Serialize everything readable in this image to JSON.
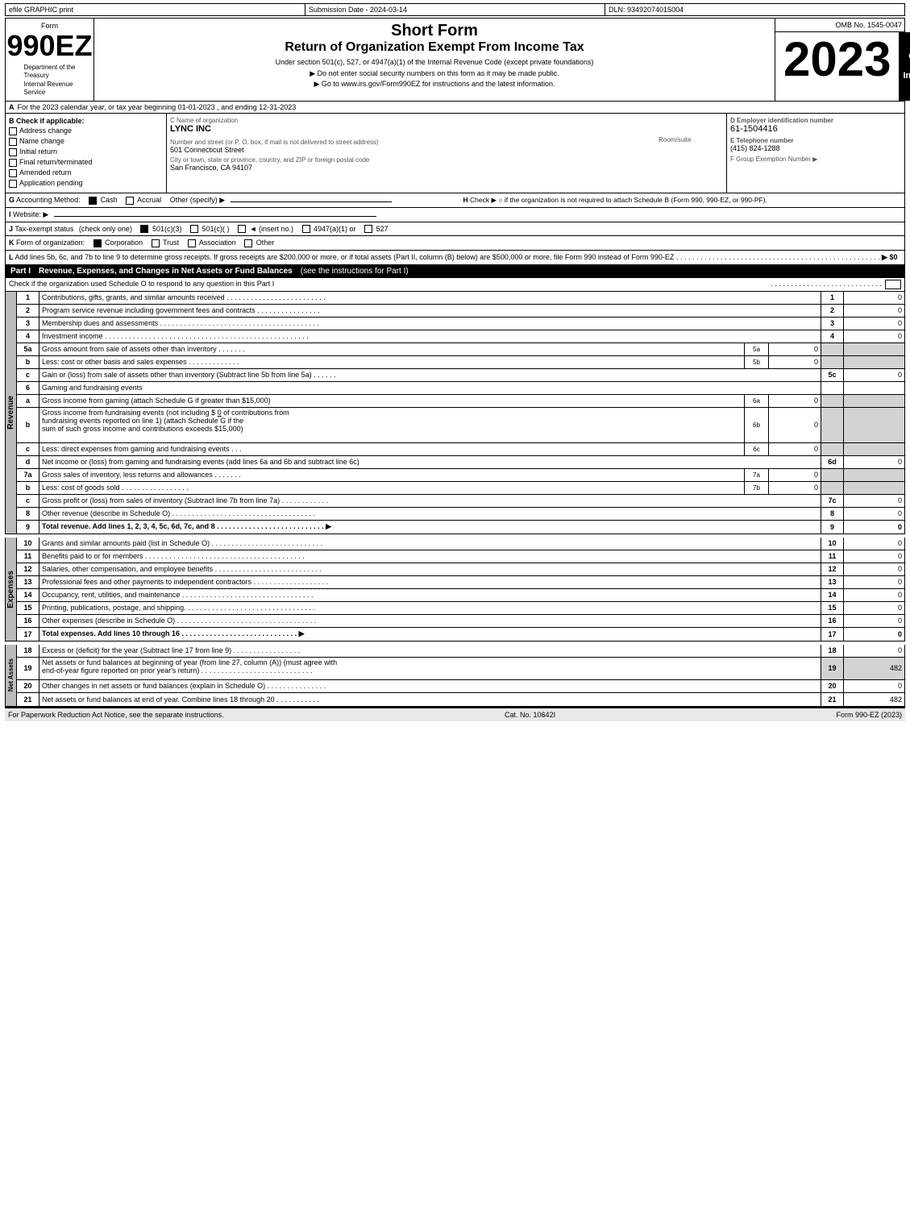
{
  "header": {
    "efile_label": "efile GRAPHIC print",
    "submission_label": "Submission Date - 2024-03-14",
    "dln_label": "DLN: 93492074015004",
    "form_label": "Form",
    "form_number": "990EZ",
    "dept_line1": "Department of the",
    "dept_line2": "Treasury",
    "dept_line3": "Internal Revenue",
    "dept_line4": "Service",
    "title_short": "Short Form",
    "title_main": "Return of Organization Exempt From Income Tax",
    "subtitle": "Under section 501(c), 527, or 4947(a)(1) of the Internal Revenue Code (except private foundations)",
    "note1": "▶ Do not enter social security numbers on this form as it may be made public.",
    "note2": "▶ Go to www.irs.gov/Form990EZ for instructions and the latest information.",
    "omb": "OMB No. 1545-0047",
    "year": "2023",
    "open_inspection": "Open to\nPublic\nInspection"
  },
  "section_a": {
    "label": "A",
    "text": "For the 2023 calendar year, or tax year beginning 01-01-2023 , and ending 12-31-2023"
  },
  "section_b": {
    "label": "B",
    "check_label": "Check if applicable:",
    "items": [
      {
        "id": "address-change",
        "label": "Address change",
        "checked": false
      },
      {
        "id": "name-change",
        "label": "Name change",
        "checked": false
      },
      {
        "id": "initial-return",
        "label": "Initial return",
        "checked": false
      },
      {
        "id": "final-return",
        "label": "Final return/terminated",
        "checked": false
      },
      {
        "id": "amended-return",
        "label": "Amended return",
        "checked": false
      },
      {
        "id": "app-pending",
        "label": "Application pending",
        "checked": false
      }
    ]
  },
  "org": {
    "name_label": "C Name of organization",
    "name": "LYNC INC",
    "address_label": "Number and street (or P. O. box, if mail is not delivered to street address)",
    "address": "501 Connecticut Street",
    "room_label": "Room/suite",
    "room": "",
    "city_label": "City or town, state or province, country, and ZIP or foreign postal code",
    "city": "San Francisco, CA  94107"
  },
  "ein": {
    "label": "D Employer identification number",
    "number": "61-1504416",
    "phone_label": "E Telephone number",
    "phone": "(415) 824-1288",
    "group_label": "F Group Exemption\nNumber",
    "group_arrow": "▶"
  },
  "accounting": {
    "label": "G",
    "method_label": "Accounting Method:",
    "cash_label": "Cash",
    "cash_checked": true,
    "accrual_label": "Accrual",
    "accrual_checked": false,
    "other_label": "Other (specify) ▶",
    "h_label": "H",
    "h_check_label": "Check ▶",
    "h_text": "○ if the organization is not required to attach Schedule B (Form 990, 990-EZ, or 990-PF)."
  },
  "website": {
    "label": "I",
    "text": "Website: ▶"
  },
  "tax_exempt": {
    "label": "J",
    "text": "Tax-exempt status",
    "note": "(check only one)",
    "options": [
      {
        "label": "501(c)(3)",
        "checked": true
      },
      {
        "label": "501(c)(  )",
        "checked": false
      },
      {
        "label": "◄ (insert no.)",
        "checked": false
      },
      {
        "label": "4947(a)(1) or",
        "checked": false
      },
      {
        "label": "527",
        "checked": false
      }
    ]
  },
  "form_org": {
    "label": "K",
    "text": "Form of organization:",
    "options": [
      {
        "label": "Corporation",
        "checked": true
      },
      {
        "label": "Trust",
        "checked": false
      },
      {
        "label": "Association",
        "checked": false
      },
      {
        "label": "Other",
        "checked": false
      }
    ]
  },
  "add_lines": {
    "label": "L",
    "text": "Add lines 5b, 6c, and 7b to line 9 to determine gross receipts. If gross receipts are $200,000 or more, or if total assets (Part II, column (B) below) are $500,000 or more, file Form 990 instead of Form 990-EZ",
    "dots": ". . . . . . . . . . . . . . . . . . . . . . . . . . . . . . . . . . . . . . . . . . . . . . . . . . .",
    "arrow": "▶ $0"
  },
  "part1": {
    "label": "Part I",
    "title": "Revenue, Expenses, and Changes in Net Assets or Fund Balances",
    "subtitle": "(see the instructions for Part I)",
    "check_note": "Check if the organization used Schedule O to respond to any question in this Part I",
    "check_dots": ". . . . . . . . . . . . . . . . . . . . . . . . . . . .",
    "check_box": "□",
    "rows": [
      {
        "num": "1",
        "desc": "Contributions, gifts, grants, and similar amounts received . . . . . . . . . . . . . . . . . . . . . . . . .",
        "line": "1",
        "amount": "0"
      },
      {
        "num": "2",
        "desc": "Program service revenue including government fees and contracts . . . . . . . . . . . . . . . .",
        "line": "2",
        "amount": "0"
      },
      {
        "num": "3",
        "desc": "Membership dues and assessments . . . . . . . . . . . . . . . . . . . . . . . . . . . . . . . . . . . . . . . .",
        "line": "3",
        "amount": "0"
      },
      {
        "num": "4",
        "desc": "Investment income . . . . . . . . . . . . . . . . . . . . . . . . . . . . . . . . . . . . . . . . . . . . . . . . . . .",
        "line": "4",
        "amount": "0"
      }
    ],
    "row5a": {
      "num": "5a",
      "desc": "Gross amount from sale of assets other than inventory . . . . . . .",
      "ref": "5a",
      "ref_val": "0"
    },
    "row5b": {
      "num": "b",
      "desc": "Less: cost or other basis and sales expenses . . . . . . . . . . . . .",
      "ref": "5b",
      "ref_val": "0"
    },
    "row5c": {
      "num": "c",
      "desc": "Gain or (loss) from sale of assets other than inventory (Subtract line 5b from line 5a) . . . . . .",
      "line": "5c",
      "amount": "0"
    },
    "row6_header": {
      "num": "6",
      "desc": "Gaming and fundraising events"
    },
    "row6a": {
      "num": "a",
      "desc": "Gross income from gaming (attach Schedule G if greater than $15,000)",
      "ref": "6a",
      "ref_val": "0"
    },
    "row6b_desc": "Gross income from fundraising events (not including $ 0                    of contributions from\nfundraising events reported on line 1) (attach Schedule G if the\nsum of such gross income and contributions exceeds $15,000)",
    "row6b": {
      "num": "b",
      "ref": "6b",
      "ref_val": "0"
    },
    "row6c": {
      "num": "c",
      "desc": "Less: direct expenses from gaming and fundraising events       .   .   .",
      "ref": "6c",
      "ref_val": "0"
    },
    "row6d": {
      "num": "d",
      "desc": "Net income or (loss) from gaming and fundraising events (add lines 6a and 6b and subtract line 6c)",
      "line": "6d",
      "amount": "0"
    },
    "row7a": {
      "num": "7a",
      "desc": "Gross sales of inventory, less returns and allowances . . . . . . .",
      "ref": "7a",
      "ref_val": "0"
    },
    "row7b": {
      "num": "b",
      "desc": "Less: cost of goods sold         .  .  .  .  .  .  .  .  .  .  .  .  .  .  .  .  .",
      "ref": "7b",
      "ref_val": "0"
    },
    "row7c": {
      "num": "c",
      "desc": "Gross profit or (loss) from sales of inventory (Subtract line 7b from line 7a)  . . . . . . . . . . . .",
      "line": "7c",
      "amount": "0"
    },
    "row8": {
      "num": "8",
      "desc": "Other revenue (describe in Schedule O) . . . . . . . . . . . . . . . . . . . . . . . . . . . . . . . . . . . .",
      "line": "8",
      "amount": "0"
    },
    "row9": {
      "num": "9",
      "desc": "Total revenue. Add lines 1, 2, 3, 4, 5c, 6d, 7c, and 8 . . . . . . . . . . . . . . . . . . . . . . . . . . .",
      "line": "9",
      "amount": "0",
      "bold": true,
      "arrow": "▶"
    }
  },
  "expenses_section": {
    "label": "Expenses",
    "rows": [
      {
        "num": "10",
        "desc": "Grants and similar amounts paid (list in Schedule O) . . . . . . . . . . . . . . . . . . . . . . . . . . . .",
        "line": "10",
        "amount": "0"
      },
      {
        "num": "11",
        "desc": "Benefits paid to or for members   . . . . . . . . . . . . . . . . . . . . . . . . . . . . . . . . . . . . . . . .",
        "line": "11",
        "amount": "0"
      },
      {
        "num": "12",
        "desc": "Salaries, other compensation, and employee benefits . . . . . . . . . . . . . . . . . . . . . . . . . . .",
        "line": "12",
        "amount": "0"
      },
      {
        "num": "13",
        "desc": "Professional fees and other payments to independent contractors . . . . . . . . . . . . . . . . . . .",
        "line": "13",
        "amount": "0"
      },
      {
        "num": "14",
        "desc": "Occupancy, rent, utilities, and maintenance . . . . . . . . . . . . . . . . . . . . . . . . . . . . . . . . .",
        "line": "14",
        "amount": "0"
      },
      {
        "num": "15",
        "desc": "Printing, publications, postage, and shipping. . . . . . . . . . . . . . . . . . . . . . . . . . . . . . . . .",
        "line": "15",
        "amount": "0"
      },
      {
        "num": "16",
        "desc": "Other expenses (describe in Schedule O)  . . . . . . . . . . . . . . . . . . . . . . . . . . . . . . . . . .",
        "line": "16",
        "amount": "0"
      },
      {
        "num": "17",
        "desc": "Total expenses. Add lines 10 through 16     . . . . . . . . . . . . . . . . . . . . . . . . . . . . . .",
        "line": "17",
        "amount": "0",
        "bold": true,
        "arrow": "▶"
      }
    ]
  },
  "net_assets_section": {
    "label": "Net Assets",
    "rows": [
      {
        "num": "18",
        "desc": "Excess or (deficit) for the year (Subtract line 17 from line 9)         . . . . . . . . . . . . . . . . .",
        "line": "18",
        "amount": "0"
      },
      {
        "num": "19",
        "desc": "Net assets or fund balances at beginning of year (from line 27, column (A)) (must agree with\nend-of-year figure reported on prior year's return)  . . . . . . . . . . . . . . . . . . . . . . . . . . . .",
        "line": "19",
        "amount": "482",
        "shaded": true
      },
      {
        "num": "20",
        "desc": "Other changes in net assets or fund balances (explain in Schedule O) . . . . . . . . . . . . . . .",
        "line": "20",
        "amount": "0"
      },
      {
        "num": "21",
        "desc": "Net assets or fund balances at end of year. Combine lines 18 through 20 . . . . . . . . . . .",
        "line": "21",
        "amount": "482"
      }
    ]
  },
  "footer": {
    "left": "For Paperwork Reduction Act Notice, see the separate instructions.",
    "cat": "Cat. No. 10642I",
    "right": "Form 990-EZ (2023)"
  }
}
